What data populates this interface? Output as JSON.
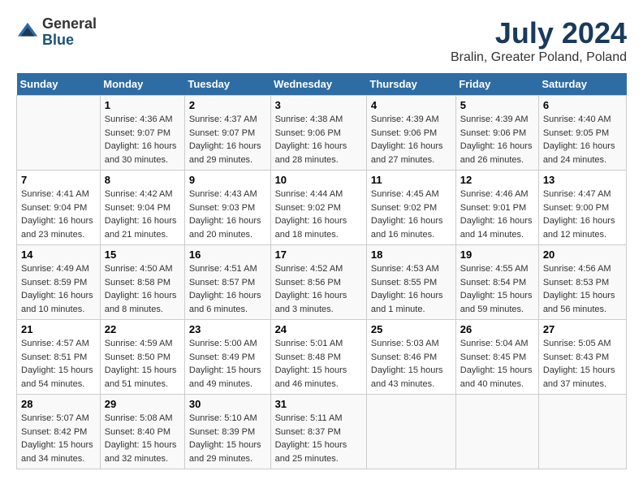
{
  "header": {
    "logo_general": "General",
    "logo_blue": "Blue",
    "main_title": "July 2024",
    "subtitle": "Bralin, Greater Poland, Poland"
  },
  "columns": [
    "Sunday",
    "Monday",
    "Tuesday",
    "Wednesday",
    "Thursday",
    "Friday",
    "Saturday"
  ],
  "weeks": [
    [
      {
        "day": "",
        "sunrise": "",
        "sunset": "",
        "daylight": ""
      },
      {
        "day": "1",
        "sunrise": "Sunrise: 4:36 AM",
        "sunset": "Sunset: 9:07 PM",
        "daylight": "Daylight: 16 hours and 30 minutes."
      },
      {
        "day": "2",
        "sunrise": "Sunrise: 4:37 AM",
        "sunset": "Sunset: 9:07 PM",
        "daylight": "Daylight: 16 hours and 29 minutes."
      },
      {
        "day": "3",
        "sunrise": "Sunrise: 4:38 AM",
        "sunset": "Sunset: 9:06 PM",
        "daylight": "Daylight: 16 hours and 28 minutes."
      },
      {
        "day": "4",
        "sunrise": "Sunrise: 4:39 AM",
        "sunset": "Sunset: 9:06 PM",
        "daylight": "Daylight: 16 hours and 27 minutes."
      },
      {
        "day": "5",
        "sunrise": "Sunrise: 4:39 AM",
        "sunset": "Sunset: 9:06 PM",
        "daylight": "Daylight: 16 hours and 26 minutes."
      },
      {
        "day": "6",
        "sunrise": "Sunrise: 4:40 AM",
        "sunset": "Sunset: 9:05 PM",
        "daylight": "Daylight: 16 hours and 24 minutes."
      }
    ],
    [
      {
        "day": "7",
        "sunrise": "Sunrise: 4:41 AM",
        "sunset": "Sunset: 9:04 PM",
        "daylight": "Daylight: 16 hours and 23 minutes."
      },
      {
        "day": "8",
        "sunrise": "Sunrise: 4:42 AM",
        "sunset": "Sunset: 9:04 PM",
        "daylight": "Daylight: 16 hours and 21 minutes."
      },
      {
        "day": "9",
        "sunrise": "Sunrise: 4:43 AM",
        "sunset": "Sunset: 9:03 PM",
        "daylight": "Daylight: 16 hours and 20 minutes."
      },
      {
        "day": "10",
        "sunrise": "Sunrise: 4:44 AM",
        "sunset": "Sunset: 9:02 PM",
        "daylight": "Daylight: 16 hours and 18 minutes."
      },
      {
        "day": "11",
        "sunrise": "Sunrise: 4:45 AM",
        "sunset": "Sunset: 9:02 PM",
        "daylight": "Daylight: 16 hours and 16 minutes."
      },
      {
        "day": "12",
        "sunrise": "Sunrise: 4:46 AM",
        "sunset": "Sunset: 9:01 PM",
        "daylight": "Daylight: 16 hours and 14 minutes."
      },
      {
        "day": "13",
        "sunrise": "Sunrise: 4:47 AM",
        "sunset": "Sunset: 9:00 PM",
        "daylight": "Daylight: 16 hours and 12 minutes."
      }
    ],
    [
      {
        "day": "14",
        "sunrise": "Sunrise: 4:49 AM",
        "sunset": "Sunset: 8:59 PM",
        "daylight": "Daylight: 16 hours and 10 minutes."
      },
      {
        "day": "15",
        "sunrise": "Sunrise: 4:50 AM",
        "sunset": "Sunset: 8:58 PM",
        "daylight": "Daylight: 16 hours and 8 minutes."
      },
      {
        "day": "16",
        "sunrise": "Sunrise: 4:51 AM",
        "sunset": "Sunset: 8:57 PM",
        "daylight": "Daylight: 16 hours and 6 minutes."
      },
      {
        "day": "17",
        "sunrise": "Sunrise: 4:52 AM",
        "sunset": "Sunset: 8:56 PM",
        "daylight": "Daylight: 16 hours and 3 minutes."
      },
      {
        "day": "18",
        "sunrise": "Sunrise: 4:53 AM",
        "sunset": "Sunset: 8:55 PM",
        "daylight": "Daylight: 16 hours and 1 minute."
      },
      {
        "day": "19",
        "sunrise": "Sunrise: 4:55 AM",
        "sunset": "Sunset: 8:54 PM",
        "daylight": "Daylight: 15 hours and 59 minutes."
      },
      {
        "day": "20",
        "sunrise": "Sunrise: 4:56 AM",
        "sunset": "Sunset: 8:53 PM",
        "daylight": "Daylight: 15 hours and 56 minutes."
      }
    ],
    [
      {
        "day": "21",
        "sunrise": "Sunrise: 4:57 AM",
        "sunset": "Sunset: 8:51 PM",
        "daylight": "Daylight: 15 hours and 54 minutes."
      },
      {
        "day": "22",
        "sunrise": "Sunrise: 4:59 AM",
        "sunset": "Sunset: 8:50 PM",
        "daylight": "Daylight: 15 hours and 51 minutes."
      },
      {
        "day": "23",
        "sunrise": "Sunrise: 5:00 AM",
        "sunset": "Sunset: 8:49 PM",
        "daylight": "Daylight: 15 hours and 49 minutes."
      },
      {
        "day": "24",
        "sunrise": "Sunrise: 5:01 AM",
        "sunset": "Sunset: 8:48 PM",
        "daylight": "Daylight: 15 hours and 46 minutes."
      },
      {
        "day": "25",
        "sunrise": "Sunrise: 5:03 AM",
        "sunset": "Sunset: 8:46 PM",
        "daylight": "Daylight: 15 hours and 43 minutes."
      },
      {
        "day": "26",
        "sunrise": "Sunrise: 5:04 AM",
        "sunset": "Sunset: 8:45 PM",
        "daylight": "Daylight: 15 hours and 40 minutes."
      },
      {
        "day": "27",
        "sunrise": "Sunrise: 5:05 AM",
        "sunset": "Sunset: 8:43 PM",
        "daylight": "Daylight: 15 hours and 37 minutes."
      }
    ],
    [
      {
        "day": "28",
        "sunrise": "Sunrise: 5:07 AM",
        "sunset": "Sunset: 8:42 PM",
        "daylight": "Daylight: 15 hours and 34 minutes."
      },
      {
        "day": "29",
        "sunrise": "Sunrise: 5:08 AM",
        "sunset": "Sunset: 8:40 PM",
        "daylight": "Daylight: 15 hours and 32 minutes."
      },
      {
        "day": "30",
        "sunrise": "Sunrise: 5:10 AM",
        "sunset": "Sunset: 8:39 PM",
        "daylight": "Daylight: 15 hours and 29 minutes."
      },
      {
        "day": "31",
        "sunrise": "Sunrise: 5:11 AM",
        "sunset": "Sunset: 8:37 PM",
        "daylight": "Daylight: 15 hours and 25 minutes."
      },
      {
        "day": "",
        "sunrise": "",
        "sunset": "",
        "daylight": ""
      },
      {
        "day": "",
        "sunrise": "",
        "sunset": "",
        "daylight": ""
      },
      {
        "day": "",
        "sunrise": "",
        "sunset": "",
        "daylight": ""
      }
    ]
  ]
}
